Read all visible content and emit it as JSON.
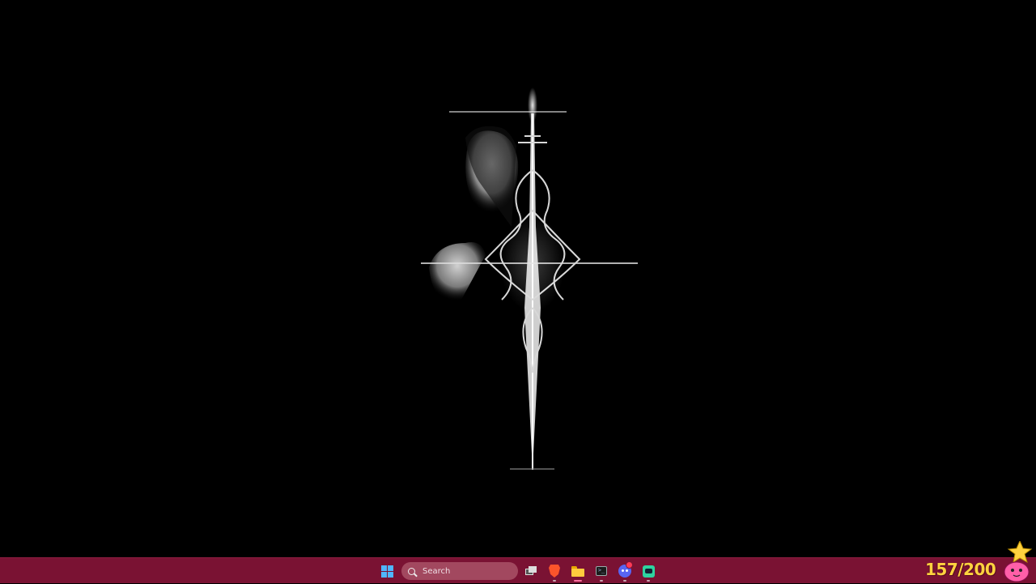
{
  "taskbar": {
    "search": {
      "placeholder": "Search"
    },
    "apps": [
      {
        "name": "task-view",
        "icon": "task-view-icon"
      },
      {
        "name": "brave-browser",
        "icon": "brave-lion-icon"
      },
      {
        "name": "file-explorer",
        "icon": "folder-icon",
        "active": true
      },
      {
        "name": "terminal",
        "icon": "terminal-icon"
      },
      {
        "name": "discord",
        "icon": "discord-icon",
        "notification": true
      },
      {
        "name": "app",
        "icon": "green-app-icon"
      }
    ],
    "counter": "157/200",
    "colors": {
      "taskbar": "#7a1233",
      "counter": "#ffd23f",
      "start": "#4fb6ff"
    }
  },
  "desktop": {
    "wallpaper": "dark-gothic-figure-with-ornate-cross"
  }
}
